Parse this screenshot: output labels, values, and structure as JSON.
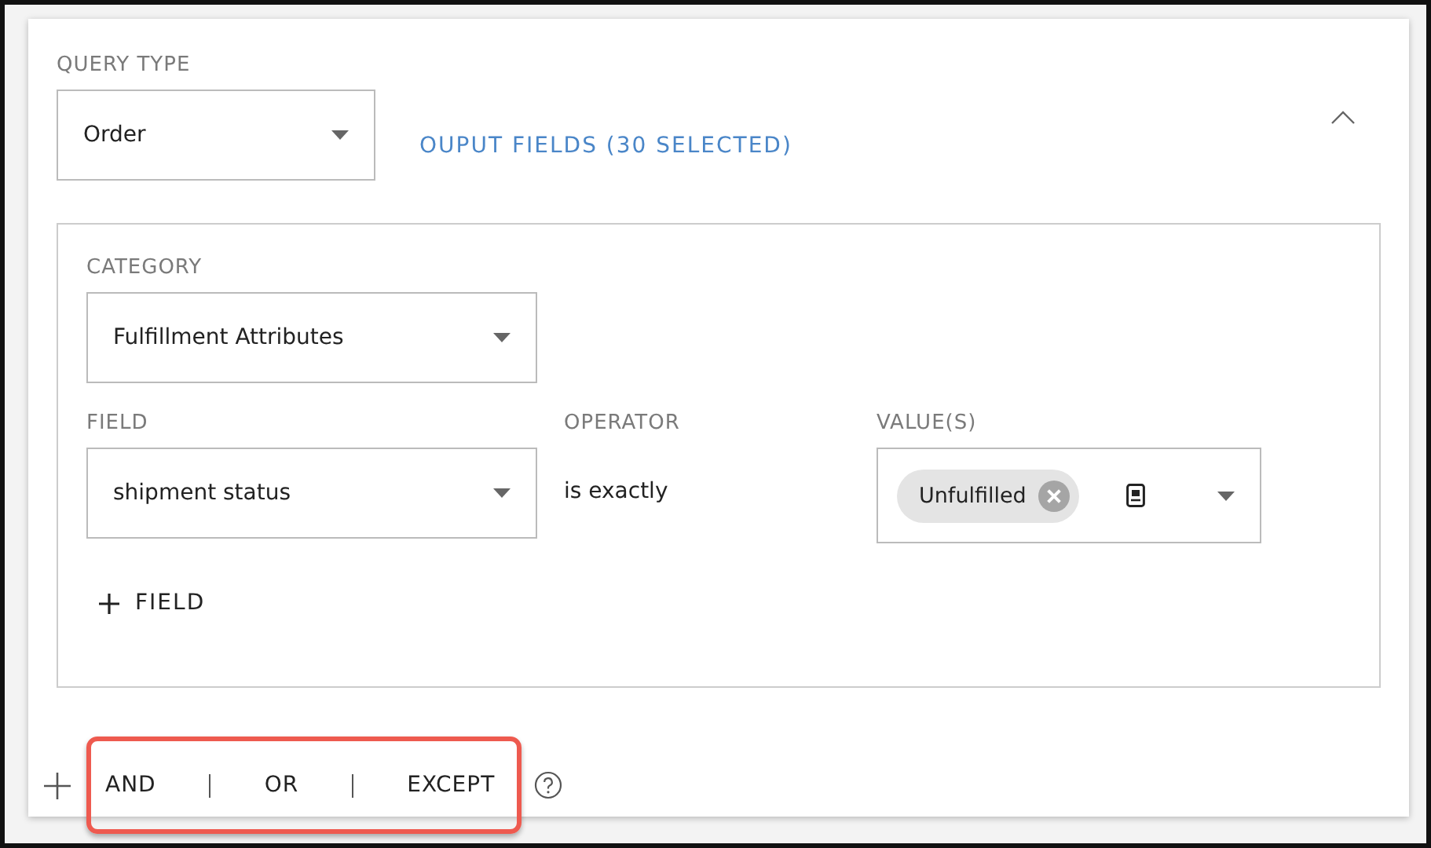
{
  "query_type": {
    "label": "QUERY TYPE",
    "value": "Order"
  },
  "output_fields_link": "OUPUT FIELDS (30 SELECTED)",
  "panel": {
    "expanded": true
  },
  "category": {
    "label": "CATEGORY",
    "value": "Fulfillment Attributes"
  },
  "field": {
    "label": "FIELD",
    "value": "shipment status"
  },
  "operator": {
    "label": "OPERATOR",
    "value": "is exactly"
  },
  "values": {
    "label": "VALUE(S)",
    "chips": [
      "Unfulfilled"
    ]
  },
  "add_field_button": "FIELD",
  "connectors": [
    "AND",
    "OR",
    "EXCEPT"
  ]
}
